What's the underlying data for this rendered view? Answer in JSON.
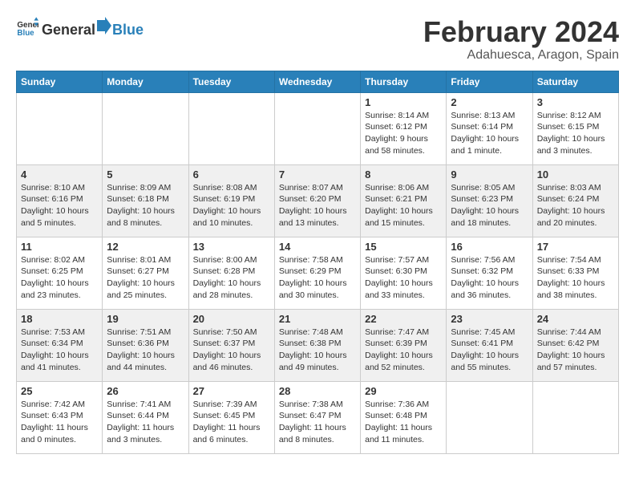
{
  "logo": {
    "text_general": "General",
    "text_blue": "Blue"
  },
  "title": "February 2024",
  "subtitle": "Adahuesca, Aragon, Spain",
  "days": [
    "Sunday",
    "Monday",
    "Tuesday",
    "Wednesday",
    "Thursday",
    "Friday",
    "Saturday"
  ],
  "weeks": [
    [
      {
        "date": "",
        "text": ""
      },
      {
        "date": "",
        "text": ""
      },
      {
        "date": "",
        "text": ""
      },
      {
        "date": "",
        "text": ""
      },
      {
        "date": "1",
        "text": "Sunrise: 8:14 AM\nSunset: 6:12 PM\nDaylight: 9 hours and 58 minutes."
      },
      {
        "date": "2",
        "text": "Sunrise: 8:13 AM\nSunset: 6:14 PM\nDaylight: 10 hours and 1 minute."
      },
      {
        "date": "3",
        "text": "Sunrise: 8:12 AM\nSunset: 6:15 PM\nDaylight: 10 hours and 3 minutes."
      }
    ],
    [
      {
        "date": "4",
        "text": "Sunrise: 8:10 AM\nSunset: 6:16 PM\nDaylight: 10 hours and 5 minutes."
      },
      {
        "date": "5",
        "text": "Sunrise: 8:09 AM\nSunset: 6:18 PM\nDaylight: 10 hours and 8 minutes."
      },
      {
        "date": "6",
        "text": "Sunrise: 8:08 AM\nSunset: 6:19 PM\nDaylight: 10 hours and 10 minutes."
      },
      {
        "date": "7",
        "text": "Sunrise: 8:07 AM\nSunset: 6:20 PM\nDaylight: 10 hours and 13 minutes."
      },
      {
        "date": "8",
        "text": "Sunrise: 8:06 AM\nSunset: 6:21 PM\nDaylight: 10 hours and 15 minutes."
      },
      {
        "date": "9",
        "text": "Sunrise: 8:05 AM\nSunset: 6:23 PM\nDaylight: 10 hours and 18 minutes."
      },
      {
        "date": "10",
        "text": "Sunrise: 8:03 AM\nSunset: 6:24 PM\nDaylight: 10 hours and 20 minutes."
      }
    ],
    [
      {
        "date": "11",
        "text": "Sunrise: 8:02 AM\nSunset: 6:25 PM\nDaylight: 10 hours and 23 minutes."
      },
      {
        "date": "12",
        "text": "Sunrise: 8:01 AM\nSunset: 6:27 PM\nDaylight: 10 hours and 25 minutes."
      },
      {
        "date": "13",
        "text": "Sunrise: 8:00 AM\nSunset: 6:28 PM\nDaylight: 10 hours and 28 minutes."
      },
      {
        "date": "14",
        "text": "Sunrise: 7:58 AM\nSunset: 6:29 PM\nDaylight: 10 hours and 30 minutes."
      },
      {
        "date": "15",
        "text": "Sunrise: 7:57 AM\nSunset: 6:30 PM\nDaylight: 10 hours and 33 minutes."
      },
      {
        "date": "16",
        "text": "Sunrise: 7:56 AM\nSunset: 6:32 PM\nDaylight: 10 hours and 36 minutes."
      },
      {
        "date": "17",
        "text": "Sunrise: 7:54 AM\nSunset: 6:33 PM\nDaylight: 10 hours and 38 minutes."
      }
    ],
    [
      {
        "date": "18",
        "text": "Sunrise: 7:53 AM\nSunset: 6:34 PM\nDaylight: 10 hours and 41 minutes."
      },
      {
        "date": "19",
        "text": "Sunrise: 7:51 AM\nSunset: 6:36 PM\nDaylight: 10 hours and 44 minutes."
      },
      {
        "date": "20",
        "text": "Sunrise: 7:50 AM\nSunset: 6:37 PM\nDaylight: 10 hours and 46 minutes."
      },
      {
        "date": "21",
        "text": "Sunrise: 7:48 AM\nSunset: 6:38 PM\nDaylight: 10 hours and 49 minutes."
      },
      {
        "date": "22",
        "text": "Sunrise: 7:47 AM\nSunset: 6:39 PM\nDaylight: 10 hours and 52 minutes."
      },
      {
        "date": "23",
        "text": "Sunrise: 7:45 AM\nSunset: 6:41 PM\nDaylight: 10 hours and 55 minutes."
      },
      {
        "date": "24",
        "text": "Sunrise: 7:44 AM\nSunset: 6:42 PM\nDaylight: 10 hours and 57 minutes."
      }
    ],
    [
      {
        "date": "25",
        "text": "Sunrise: 7:42 AM\nSunset: 6:43 PM\nDaylight: 11 hours and 0 minutes."
      },
      {
        "date": "26",
        "text": "Sunrise: 7:41 AM\nSunset: 6:44 PM\nDaylight: 11 hours and 3 minutes."
      },
      {
        "date": "27",
        "text": "Sunrise: 7:39 AM\nSunset: 6:45 PM\nDaylight: 11 hours and 6 minutes."
      },
      {
        "date": "28",
        "text": "Sunrise: 7:38 AM\nSunset: 6:47 PM\nDaylight: 11 hours and 8 minutes."
      },
      {
        "date": "29",
        "text": "Sunrise: 7:36 AM\nSunset: 6:48 PM\nDaylight: 11 hours and 11 minutes."
      },
      {
        "date": "",
        "text": ""
      },
      {
        "date": "",
        "text": ""
      }
    ]
  ]
}
